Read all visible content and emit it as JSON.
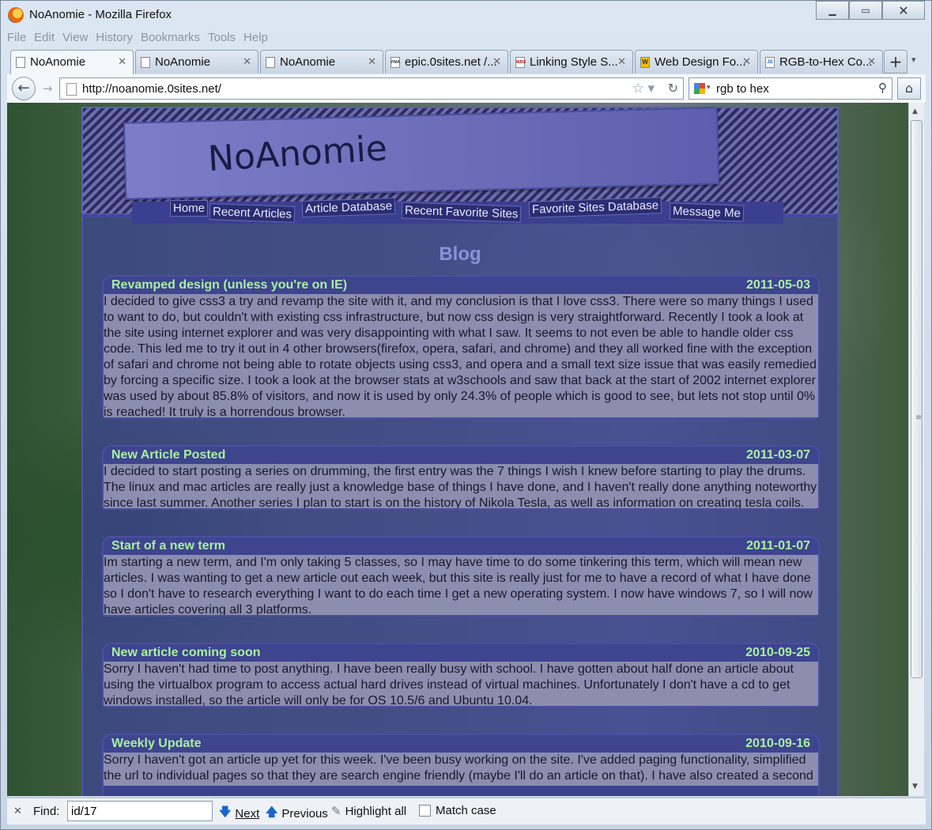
{
  "window": {
    "title": "NoAnomie - Mozilla Firefox"
  },
  "menu": [
    "File",
    "Edit",
    "View",
    "History",
    "Bookmarks",
    "Tools",
    "Help"
  ],
  "tabs": [
    {
      "label": "NoAnomie",
      "icon": "page-icon",
      "active": true
    },
    {
      "label": "NoAnomie",
      "icon": "page-icon"
    },
    {
      "label": "NoAnomie",
      "icon": "page-icon"
    },
    {
      "label": "epic.0sites.net /...",
      "icon": "phpmyadmin-icon",
      "icon_text": "PMA"
    },
    {
      "label": "Linking Style S...",
      "icon": "w3c-icon",
      "icon_text": "WDG"
    },
    {
      "label": "Web Design Fo...",
      "icon": "w-icon",
      "icon_text": "W"
    },
    {
      "label": "RGB-to-Hex Co...",
      "icon": "js-icon",
      "icon_text": "JS"
    }
  ],
  "nav": {
    "url": "http://noanomie.0sites.net/",
    "search_text": "rgb to hex"
  },
  "site": {
    "logo_text": "NoAnomie",
    "nav_links": [
      "Home",
      "Recent Articles",
      "Article Database",
      "Recent Favorite Sites",
      "Favorite Sites Database",
      "Message Me"
    ],
    "heading": "Blog"
  },
  "posts": [
    {
      "title": "Revamped design (unless you're on IE)",
      "date": "2011-05-03",
      "body": "I decided to give css3 a try and revamp the site with it, and my conclusion is that I love css3. There were so many things I used to want to do, but couldn't with existing css infrastructure, but now css design is very straightforward. Recently I took a look at the site using internet explorer and was very disappointing with what I saw. It seems to not even be able to handle older css code. This led me to try it out in 4 other browsers(firefox, opera, safari, and chrome) and they all worked fine with the exception of safari and chrome not being able to rotate objects using css3, and opera and a small text size issue that was easily remedied by forcing a specific size. I took a look at the browser stats at w3schools and saw that back at the start of 2002 internet explorer was used by about 85.8% of visitors, and now it is used by only 24.3% of people which is good to see, but lets not stop until 0% is reached! It truly is a horrendous browser."
    },
    {
      "title": "New Article Posted",
      "date": "2011-03-07",
      "body": "I decided to start posting a series on drumming, the first entry was the 7 things I wish I knew before starting to play the drums. The linux and mac articles are really just a knowledge base of things I have done, and I haven't really done anything noteworthy since last summer. Another series I plan to start is on the history of Nikola Tesla, as well as information on creating tesla coils."
    },
    {
      "title": "Start of a new term",
      "date": "2011-01-07",
      "body": "Im starting a new term, and I'm only taking 5 classes, so I may have time to do some tinkering this term, which will mean new articles.  I was wanting to get a new article out each week, but this site is really just for me to have a record of what I have done so I don't have to research everything I want to do each time I get a new operating system. I now have windows 7, so I will now have articles covering all 3 platforms."
    },
    {
      "title": "New article coming soon",
      "date": "2010-09-25",
      "body": "Sorry I haven't had time to post anything. I have been really busy with school.  I have gotten about half done an article about using the virtualbox program to access actual hard drives instead of virtual machines.  Unfortunately I don't have a cd to get windows installed, so the article will only be for OS 10.5/6 and Ubuntu 10.04."
    },
    {
      "title": "Weekly Update",
      "date": "2010-09-16",
      "body": "Sorry I haven't got an article up yet for this week.  I've been busy working on the site.  I've added paging functionality, simplified the url to individual pages so that they are search engine friendly (maybe I'll do an article on that).  I have also created a second"
    }
  ],
  "findbar": {
    "label": "Find:",
    "value": "id/17",
    "next": "Next",
    "previous": "Previous",
    "highlight_all": "Highlight all",
    "match_case": "Match case"
  }
}
